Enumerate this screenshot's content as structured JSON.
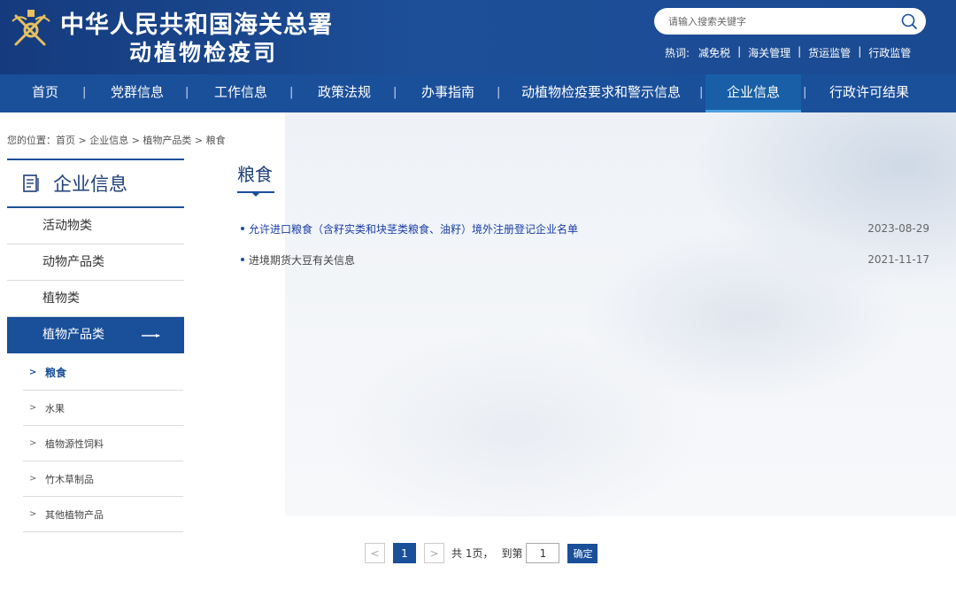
{
  "header": {
    "title": "中华人民共和国海关总署",
    "subtitle": "动植物检疫司",
    "search_placeholder": "请输入搜索关键字",
    "hot_label": "热词:",
    "hot_words": [
      "减免税",
      "海关管理",
      "货运监管",
      "行政监管"
    ],
    "hot_separator": "|"
  },
  "nav": {
    "items": [
      {
        "label": "首页",
        "active": false
      },
      {
        "label": "党群信息",
        "active": false
      },
      {
        "label": "工作信息",
        "active": false
      },
      {
        "label": "政策法规",
        "active": false
      },
      {
        "label": "办事指南",
        "active": false
      },
      {
        "label": "动植物检疫要求和警示信息",
        "active": false
      },
      {
        "label": "企业信息",
        "active": true
      },
      {
        "label": "行政许可结果",
        "active": false
      }
    ],
    "separator": "|"
  },
  "breadcrumb": "您的位置：首页 > 企业信息 > 植物产品类 > 粮食",
  "sidebar": {
    "title": "企业信息",
    "items": [
      {
        "label": "活动物类"
      },
      {
        "label": "动物产品类"
      },
      {
        "label": "植物类"
      },
      {
        "label": "植物产品类",
        "active": true
      }
    ],
    "sub_items": [
      {
        "label": "粮食",
        "active": true
      },
      {
        "label": "水果"
      },
      {
        "label": "植物源性饲料"
      },
      {
        "label": "竹木草制品"
      },
      {
        "label": "其他植物产品"
      }
    ],
    "chevron": ">"
  },
  "content": {
    "title": "粮食",
    "articles": [
      {
        "title": "允许进口粮食（含籽实类和块茎类粮食、油籽）境外注册登记企业名单",
        "date": "2023-08-29",
        "color": "#1a3fa8"
      },
      {
        "title": "进境期货大豆有关信息",
        "date": "2021-11-17",
        "color": "#444444"
      }
    ]
  },
  "pagination": {
    "prev": "<",
    "current": "1",
    "next": ">",
    "total_text": "共 1页，",
    "goto_text": "到第",
    "goto_value": "1",
    "confirm": "确定"
  },
  "colors": {
    "primary": "#1a4f9a",
    "header_bg": "#153b7e",
    "link": "#1a3fa8"
  }
}
